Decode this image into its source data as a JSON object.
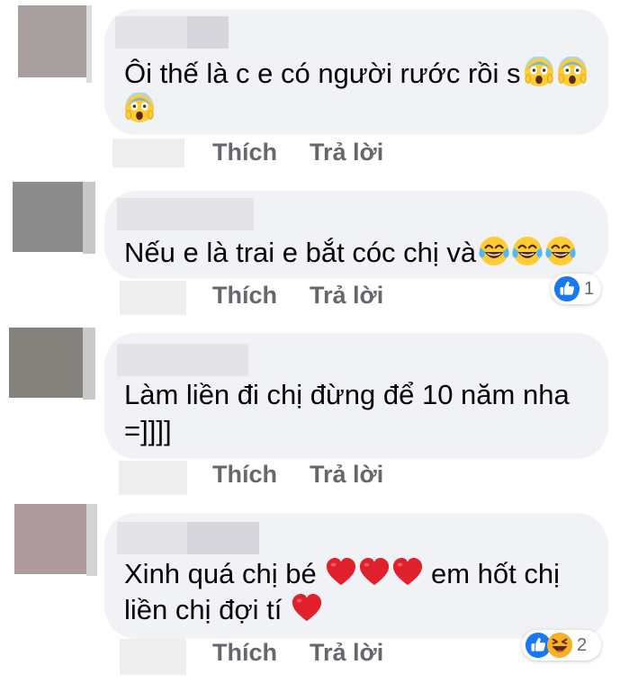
{
  "comments": [
    {
      "text_lines": [
        "Ôi thế là c e có người rước rồi s",
        ""
      ],
      "reactions": null
    },
    {
      "text_lines": [
        "Nếu e là trai e bắt cóc chị và"
      ],
      "reactions": {
        "count": "1",
        "icons": [
          "like-icon"
        ]
      }
    },
    {
      "text_lines": [
        "Làm liền đi chị đừng để 10 năm nha",
        "=]]]]"
      ],
      "reactions": null
    },
    {
      "text_lines": [
        "Xinh quá chị bé",
        "em hốt chị",
        "liền chị đợi tí"
      ],
      "reactions": {
        "count": "2",
        "icons": [
          "like-icon",
          "haha-icon"
        ]
      }
    }
  ],
  "actions": {
    "like_label": "Thích",
    "reply_label": "Trả lời"
  },
  "emoji": {
    "c1": [
      "screaming-face-icon",
      "screaming-face-icon",
      "screaming-face-icon"
    ],
    "c2": [
      "tears-of-joy-icon",
      "tears-of-joy-icon",
      "tears-of-joy-icon"
    ],
    "c4": [
      "red-heart-icon",
      "red-heart-icon",
      "red-heart-icon",
      "red-heart-icon"
    ]
  },
  "colors": {
    "bubble": "#f0f2f5",
    "text": "#050505",
    "action": "#65676b",
    "like_blue": "#1877f2"
  }
}
